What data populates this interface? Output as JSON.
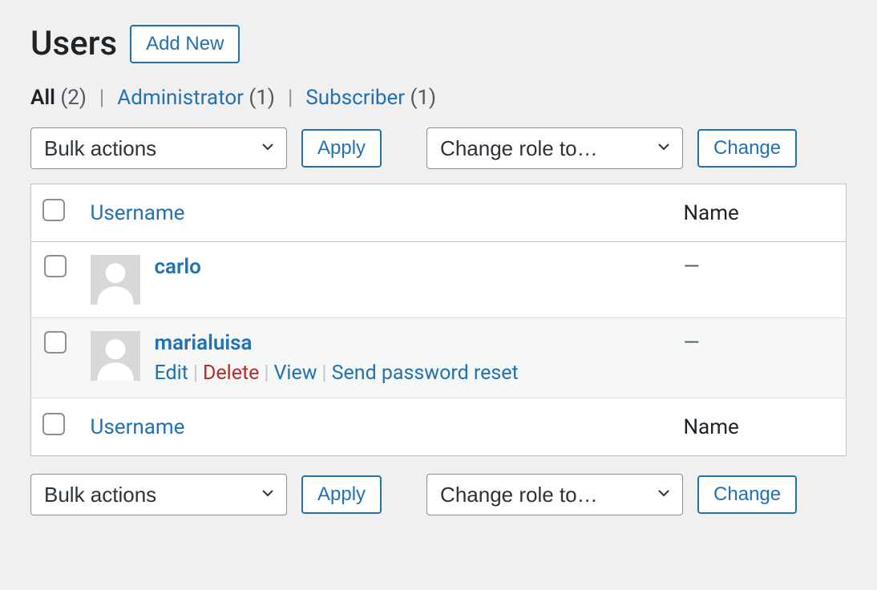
{
  "header": {
    "title": "Users",
    "add_new": "Add New"
  },
  "filters": {
    "all_label": "All",
    "all_count": "(2)",
    "admin_label": "Administrator",
    "admin_count": "(1)",
    "sub_label": "Subscriber",
    "sub_count": "(1)"
  },
  "actions": {
    "bulk_label": "Bulk actions",
    "apply": "Apply",
    "role_label": "Change role to…",
    "change": "Change"
  },
  "columns": {
    "username": "Username",
    "name": "Name"
  },
  "rows": [
    {
      "username": "carlo",
      "name": "—",
      "show_actions": false
    },
    {
      "username": "marialuisa",
      "name": "—",
      "show_actions": true
    }
  ],
  "row_actions": {
    "edit": "Edit",
    "delete": "Delete",
    "view": "View",
    "reset": "Send password reset"
  }
}
